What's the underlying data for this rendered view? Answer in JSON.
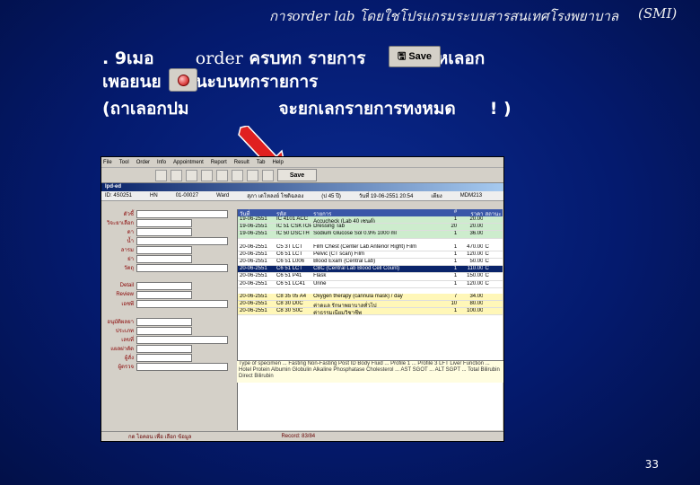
{
  "header": {
    "title": "การorder lab โดยใชโปรแกรมระบบสารสนเทศโรงพยาบาล",
    "title_suffix": "(SMI)"
  },
  "instructions": {
    "line1_num": ". 9เมอ",
    "line1_order": "order",
    "line1_rest": " ครบทก   รายการ",
    "line1_end": "ใหเลอก",
    "line2_start": "เพอยนย",
    "line2_end": "นะบนทกรายการ",
    "line3_start": "(ถาเลอกปม",
    "line3_mid": "จะยกเลกรายการทงหมด",
    "line3_end": "! )"
  },
  "save_button": {
    "label": "Save"
  },
  "app_screenshot": {
    "menu": [
      "File",
      "Tool",
      "Order",
      "Info",
      "Appointment",
      "Report",
      "Result",
      "Tab",
      "Help"
    ],
    "toolbar_save": "Save",
    "window_title": "Ipd-ed",
    "patient": [
      "ID: 4S0251",
      "HN",
      "01-00027",
      "Ward",
      "สุภา เดโหลงย์ โชติฉลอง",
      "(ป 45 ปี)",
      "วันที่ 19-06-2551  20:54",
      "เตียง",
      "MDM213"
    ],
    "left_labels": [
      "ตัวชี้",
      "วิจะยาเลือก",
      "ดา",
      "น้ำ",
      "ลารม",
      "ย่า",
      "วัตถุ",
      "Detail",
      "Review",
      "เอชพี",
      "อนุมัติผลยา",
      "ประเภท",
      "เลขที่",
      "แผลผ่าตัด",
      "ผู้สั่ง",
      "ผู้ตรวจ"
    ],
    "table_header": [
      "วันที่",
      "รหัส",
      "รายการ",
      "#",
      "ราคา",
      "สถานะ"
    ],
    "rows": [
      {
        "d": "19-06-2551",
        "c": "IC 4101 ACC",
        "n": "Accucheck (Lab 40 เซนต์)",
        "q": "1",
        "p": "20.00",
        "s": "",
        "cls": "green"
      },
      {
        "d": "19-06-2551",
        "c": "IC 51 CSKTOP",
        "n": "Dressing Tab",
        "q": "20",
        "p": "20.00",
        "s": "",
        "cls": "green"
      },
      {
        "d": "19-06-2551",
        "c": "IC 50 DSCTH",
        "n": "Sodium Glucose Sol 0.9% 1000 ml",
        "q": "1",
        "p": "36.00",
        "s": "",
        "cls": "green"
      },
      {
        "d": "",
        "c": "",
        "n": "",
        "q": "",
        "p": "",
        "s": "",
        "cls": "gap"
      },
      {
        "d": "20-06-2551",
        "c": "C5 3T LCT",
        "n": "Film Chest (Center Lab Anterior Right) Film",
        "q": "1",
        "p": "470.00",
        "s": "C",
        "cls": ""
      },
      {
        "d": "20-06-2551",
        "c": "C6 51 LCT",
        "n": "Pelvic (CT scan) Film",
        "q": "1",
        "p": "120.00",
        "s": "C",
        "cls": ""
      },
      {
        "d": "20-06-2551",
        "c": "C6 51 L006",
        "n": "Blood Exam (Central Lab)",
        "q": "1",
        "p": "50.00",
        "s": "C",
        "cls": ""
      },
      {
        "d": "20-06-2551",
        "c": "C6 51 LCT",
        "n": "CBC (Central Lab Blood Cell Count)",
        "q": "1",
        "p": "110.00",
        "s": "C",
        "cls": "sel"
      },
      {
        "d": "20-06-2551",
        "c": "C6 51 P41",
        "n": "Flask",
        "q": "1",
        "p": "150.00",
        "s": "C",
        "cls": ""
      },
      {
        "d": "20-06-2551",
        "c": "C6 51 LC41",
        "n": "Urine",
        "q": "1",
        "p": "120.00",
        "s": "C",
        "cls": ""
      },
      {
        "d": "",
        "c": "",
        "n": "",
        "q": "",
        "p": "",
        "s": "",
        "cls": "gap"
      },
      {
        "d": "20-06-2551",
        "c": "C8 35 05 A4",
        "n": "Oxygen therapy (cannula mask) / day",
        "q": "7",
        "p": "34.00",
        "s": "",
        "cls": "yellow"
      },
      {
        "d": "20-06-2551",
        "c": "C8 30 D0C",
        "n": "ค่าดูแล รักษาพยาบาลทั่วไป",
        "q": "10",
        "p": "80.00",
        "s": "",
        "cls": "yellow"
      },
      {
        "d": "20-06-2551",
        "c": "C8 30 S0C",
        "n": "ค่าธรรมเนียมวิชาชีพ",
        "q": "1",
        "p": "100.00",
        "s": "",
        "cls": "yellow"
      }
    ],
    "notes": "Type of specimen ... Fasting Non-Fasting Post ID Body Fluid ... Profile 1 ... Profile 3 LFT Liver Function ... Hotel Protein Albumin Globulin Alkaline Phosphatase Cholesterol ... AST SGOT ... ALT SGPT ... Total Bilirubin Direct Bilirubin",
    "status_left": "กด ไอคอน เพื่อ เลือก ข้อมูล",
    "status_right": "Record: 83/84"
  },
  "page_number": "33"
}
